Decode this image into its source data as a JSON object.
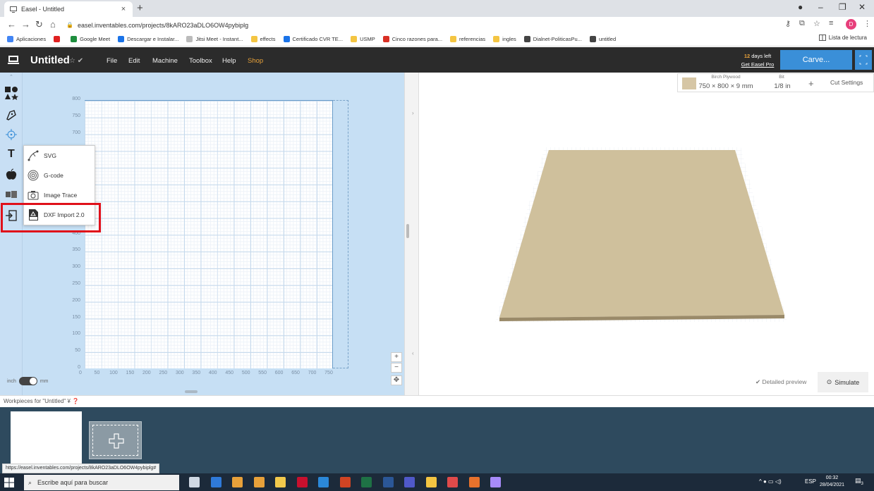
{
  "browser": {
    "tab_title": "Easel - Untitled",
    "tab_close": "×",
    "new_tab": "+",
    "url": "easel.inventables.com/projects/8kARO23aDLO6OW4pybiplg",
    "bookmarks": [
      {
        "label": "Aplicaciones",
        "color": "#4285f4"
      },
      {
        "label": "",
        "color": "#e02020"
      },
      {
        "label": "Google Meet",
        "color": "#1e8e3e"
      },
      {
        "label": "Descargar e Instalar...",
        "color": "#1a73e8"
      },
      {
        "label": "Jitsi Meet - Instant...",
        "color": "#bbbbbb"
      },
      {
        "label": "effects",
        "color": "#f4c542"
      },
      {
        "label": "Certificado CVR TE...",
        "color": "#1a73e8"
      },
      {
        "label": "USMP",
        "color": "#f4c542"
      },
      {
        "label": "Cinco razones para...",
        "color": "#d93025"
      },
      {
        "label": "referencias",
        "color": "#f4c542"
      },
      {
        "label": "ingles",
        "color": "#f4c542"
      },
      {
        "label": "Dialnet-PoliticasPu...",
        "color": "#444444"
      },
      {
        "label": "untitled",
        "color": "#444444"
      }
    ],
    "reading_list": "Lista de lectura",
    "profile_initial": "D",
    "status_url": "https://easel.inventables.com/projects/8kARO23aDLO6OW4pybiplg#"
  },
  "easel": {
    "project_title": "Untitled",
    "menu": [
      "File",
      "Edit",
      "Machine",
      "Toolbox",
      "Help",
      "Shop"
    ],
    "days_left_num": "12",
    "days_left_text": "days left",
    "get_pro": "Get Easel Pro",
    "carve_label": "Carve...",
    "brand_color": "#3a8fd8",
    "y_ticks": [
      "800",
      "750",
      "700",
      "400",
      "350",
      "300",
      "250",
      "200",
      "150",
      "100",
      "50",
      "0"
    ],
    "x_ticks": [
      "0",
      "50",
      "100",
      "150",
      "200",
      "250",
      "300",
      "350",
      "400",
      "450",
      "500",
      "550",
      "600",
      "650",
      "700",
      "750"
    ],
    "units_left": "inch",
    "units_right": "mm",
    "import_menu": [
      {
        "label": "SVG",
        "icon": "svg-icon"
      },
      {
        "label": "G-code",
        "icon": "gcode-icon"
      },
      {
        "label": "Image Trace",
        "icon": "camera-icon"
      },
      {
        "label": "DXF Import 2.0",
        "icon": "dxf-icon"
      }
    ],
    "highlight_color": "#e0101a",
    "material": {
      "name": "Birch Plywood",
      "size": "750 × 800 × 9 mm",
      "bit_label": "Bit",
      "bit_value": "1/8 in",
      "add": "+",
      "cut_settings": "Cut Settings"
    },
    "detailed_preview": "Detailed preview",
    "simulate": "Simulate",
    "workpieces_header": "Workpieces for \"Untitled\""
  },
  "taskbar": {
    "search_placeholder": "Escribe aquí para buscar",
    "lang": "ESP",
    "time": "00:32",
    "date": "28/04/2021",
    "notifications": "3"
  }
}
